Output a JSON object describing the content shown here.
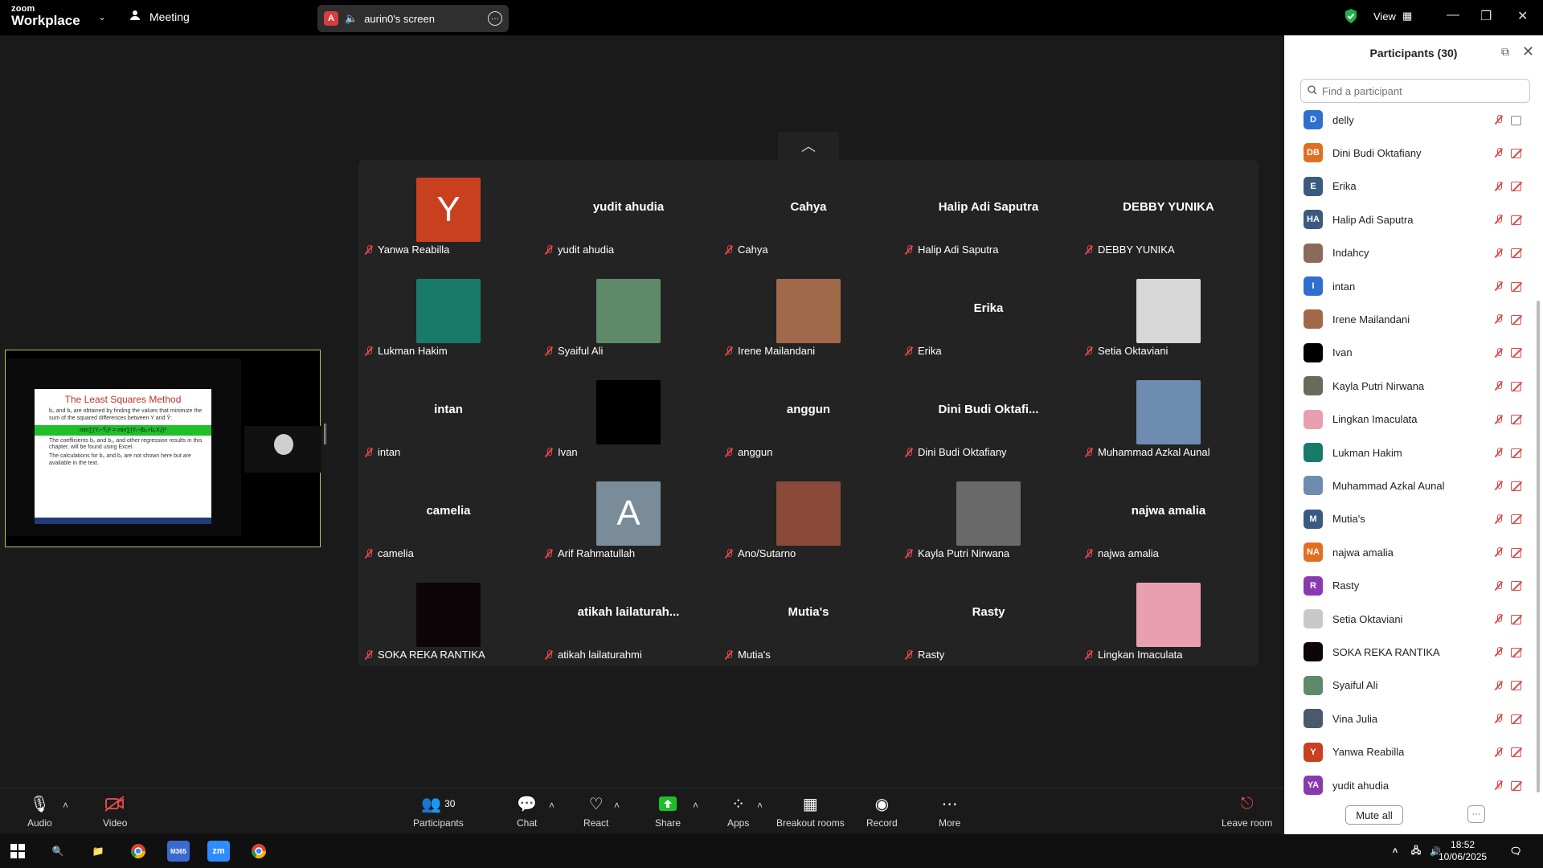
{
  "app": {
    "logo_top": "zoom",
    "logo_bottom": "Workplace",
    "meeting_label": "Meeting"
  },
  "share": {
    "badge": "A",
    "label": "aurin0's screen"
  },
  "view_label": "View",
  "slide": {
    "title": "The Least Squares Method",
    "bullet1": "b₀ and b₁ are obtained by finding the values that minimize the sum of the squared differences between Y and Ŷ:",
    "equation": "min∑(Yᵢ−Ŷᵢ)² = min∑(Yᵢ−(b₀+b₁Xᵢ))²",
    "bullet2": "The coefficients b₀ and b₁, and other regression results in this chapter, will be found using Excel.",
    "bullet3": "The calculations for b₀ and b₁ are not shown here but are available in the text."
  },
  "gallery": [
    {
      "name": "Yanwa Reabilla",
      "label": "",
      "avatar_letter": "Y",
      "avatar_color": "#c9401f"
    },
    {
      "name": "yudit ahudia",
      "label": "yudit ahudia"
    },
    {
      "name": "Cahya",
      "label": "Cahya"
    },
    {
      "name": "Halip Adi Saputra",
      "label": "Halip Adi Saputra"
    },
    {
      "name": "DEBBY YUNIKA",
      "label": "DEBBY YUNIKA"
    },
    {
      "name": "Lukman Hakim",
      "label": "",
      "photo_color": "#1a7a6a"
    },
    {
      "name": "Syaiful Ali",
      "label": "",
      "photo_color": "#5f8a6a"
    },
    {
      "name": "Irene Mailandani",
      "label": "",
      "photo_color": "#a06a4a"
    },
    {
      "name": "Erika",
      "label": "Erika"
    },
    {
      "name": "Setia Oktaviani",
      "label": "",
      "photo_color": "#d7d7d7"
    },
    {
      "name": "intan",
      "label": "intan"
    },
    {
      "name": "Ivan",
      "label": "",
      "photo_color": "#000000"
    },
    {
      "name": "anggun",
      "label": "anggun"
    },
    {
      "name": "Dini Budi Oktafiany",
      "label": "Dini  Budi  Oktafi..."
    },
    {
      "name": "Muhammad Azkal Aunal",
      "label": "",
      "photo_color": "#6e8cb0"
    },
    {
      "name": "camelia",
      "label": "camelia"
    },
    {
      "name": "Arif Rahmatullah",
      "label": "",
      "avatar_letter": "A",
      "avatar_color": "#7a8c99"
    },
    {
      "name": "Ano/Sutarno",
      "label": "",
      "photo_color": "#8a4a3a"
    },
    {
      "name": "Kayla Putri Nirwana",
      "label": "",
      "photo_color": "#6a6a6a"
    },
    {
      "name": "najwa amalia",
      "label": "najwa amalia"
    },
    {
      "name": "SOKA REKA RANTIKA",
      "label": "",
      "photo_color": "#0d0508"
    },
    {
      "name": "atikah lailaturahmi",
      "label": "atikah  lailaturah..."
    },
    {
      "name": "Mutia's",
      "label": "Mutia's"
    },
    {
      "name": "Rasty",
      "label": "Rasty"
    },
    {
      "name": "Lingkan Imaculata",
      "label": "",
      "photo_color": "#e8a0b0"
    }
  ],
  "participants": {
    "title": "Participants (30)",
    "search_placeholder": "Find a participant",
    "list": [
      {
        "initials": "D",
        "name": "delly",
        "color": "#2f6fd0",
        "video": "on"
      },
      {
        "initials": "DB",
        "name": "Dini Budi Oktafiany",
        "color": "#e0701f",
        "video": "off"
      },
      {
        "initials": "E",
        "name": "Erika",
        "color": "#3a5a80",
        "video": "off"
      },
      {
        "initials": "HA",
        "name": "Halip Adi Saputra",
        "color": "#3a5a80",
        "video": "off"
      },
      {
        "initials": "",
        "name": "Indahcy",
        "color": "#8a6a5a",
        "video": "off"
      },
      {
        "initials": "I",
        "name": "intan",
        "color": "#2f6fd0",
        "video": "off"
      },
      {
        "initials": "",
        "name": "Irene Mailandani",
        "color": "#a06a4a",
        "video": "off"
      },
      {
        "initials": "",
        "name": "Ivan",
        "color": "#000000",
        "video": "off"
      },
      {
        "initials": "",
        "name": "Kayla Putri Nirwana",
        "color": "#6a6a5a",
        "video": "off"
      },
      {
        "initials": "",
        "name": "Lingkan Imaculata",
        "color": "#e8a0b0",
        "video": "off"
      },
      {
        "initials": "",
        "name": "Lukman Hakim",
        "color": "#1a7a6a",
        "video": "off"
      },
      {
        "initials": "",
        "name": "Muhammad Azkal Aunal",
        "color": "#6e8cb0",
        "video": "off"
      },
      {
        "initials": "M",
        "name": "Mutia's",
        "color": "#3a5a80",
        "video": "off"
      },
      {
        "initials": "NA",
        "name": "najwa amalia",
        "color": "#e0701f",
        "video": "off"
      },
      {
        "initials": "R",
        "name": "Rasty",
        "color": "#8a3ab0",
        "video": "off"
      },
      {
        "initials": "",
        "name": "Setia Oktaviani",
        "color": "#c8c8c8",
        "video": "off"
      },
      {
        "initials": "",
        "name": "SOKA REKA RANTIKA",
        "color": "#0d0508",
        "video": "off"
      },
      {
        "initials": "",
        "name": "Syaiful Ali",
        "color": "#5f8a6a",
        "video": "off"
      },
      {
        "initials": "",
        "name": "Vina Julia",
        "color": "#4a5a6a",
        "video": "off"
      },
      {
        "initials": "Y",
        "name": "Yanwa Reabilla",
        "color": "#c9401f",
        "video": "off"
      },
      {
        "initials": "YA",
        "name": "yudit ahudia",
        "color": "#8a3ab0",
        "video": "off"
      }
    ],
    "mute_all": "Mute all",
    "more": "···"
  },
  "toolbar": {
    "audio": "Audio",
    "video": "Video",
    "participants": "Participants",
    "participants_count": "30",
    "chat": "Chat",
    "react": "React",
    "share": "Share",
    "apps": "Apps",
    "breakout": "Breakout rooms",
    "record": "Record",
    "more": "More",
    "leave": "Leave room"
  },
  "taskbar": {
    "time": "18:52",
    "date": "10/06/2025",
    "m365": "M365",
    "zoom": "zm"
  },
  "colors": {
    "accent_green": "#1fbf2a",
    "mute_red": "#e04848"
  }
}
